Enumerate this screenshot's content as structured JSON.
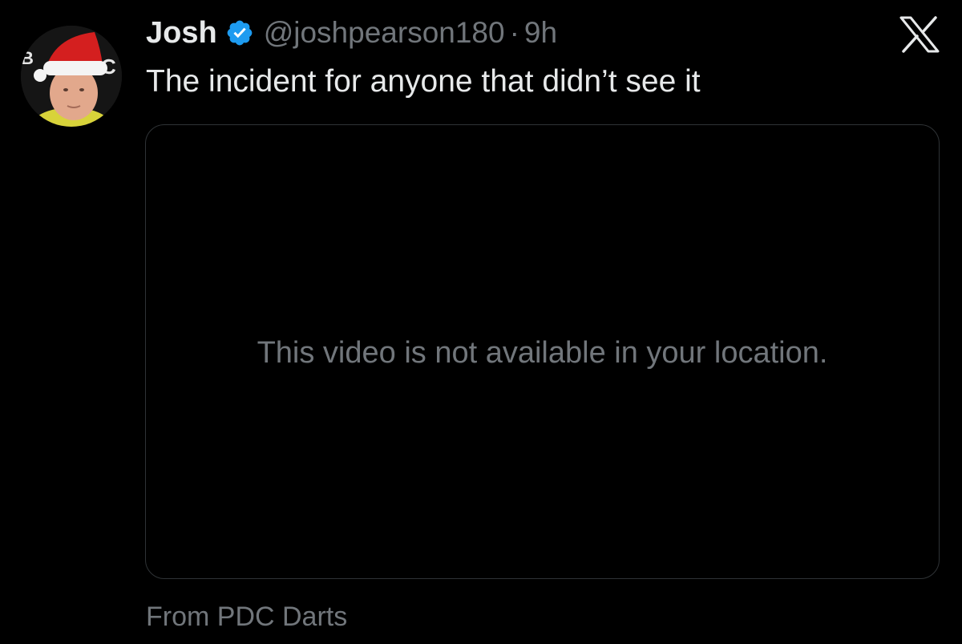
{
  "tweet": {
    "author": {
      "display_name": "Josh",
      "verified": true,
      "verified_color": "#1d9bf0",
      "handle": "@joshpearson180",
      "avatar_icon": "profile-photo-santa-hat"
    },
    "separator": "·",
    "time": "9h",
    "text": "The incident for anyone that didn’t see it",
    "media": {
      "message": "This video is not available in your location."
    },
    "source": "From PDC Darts"
  },
  "app": {
    "logo_icon": "x-logo-icon"
  },
  "colors": {
    "background": "#000000",
    "text_primary": "#e7e9ea",
    "text_secondary": "#71767b",
    "border": "#2f3336",
    "accent": "#1d9bf0"
  }
}
